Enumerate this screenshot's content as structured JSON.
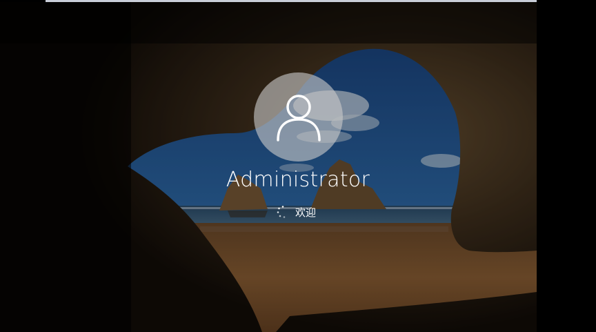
{
  "login": {
    "username": "Administrator",
    "status_text": "欢迎"
  },
  "icons": {
    "avatar": "user-icon",
    "spinner": "loading-spinner-icon"
  },
  "colors": {
    "avatar_bg": "#c8c8c8",
    "text": "#ffffff",
    "sky": "#2a5f9e",
    "sand": "#8a5d34",
    "cave": "#1a120b"
  }
}
